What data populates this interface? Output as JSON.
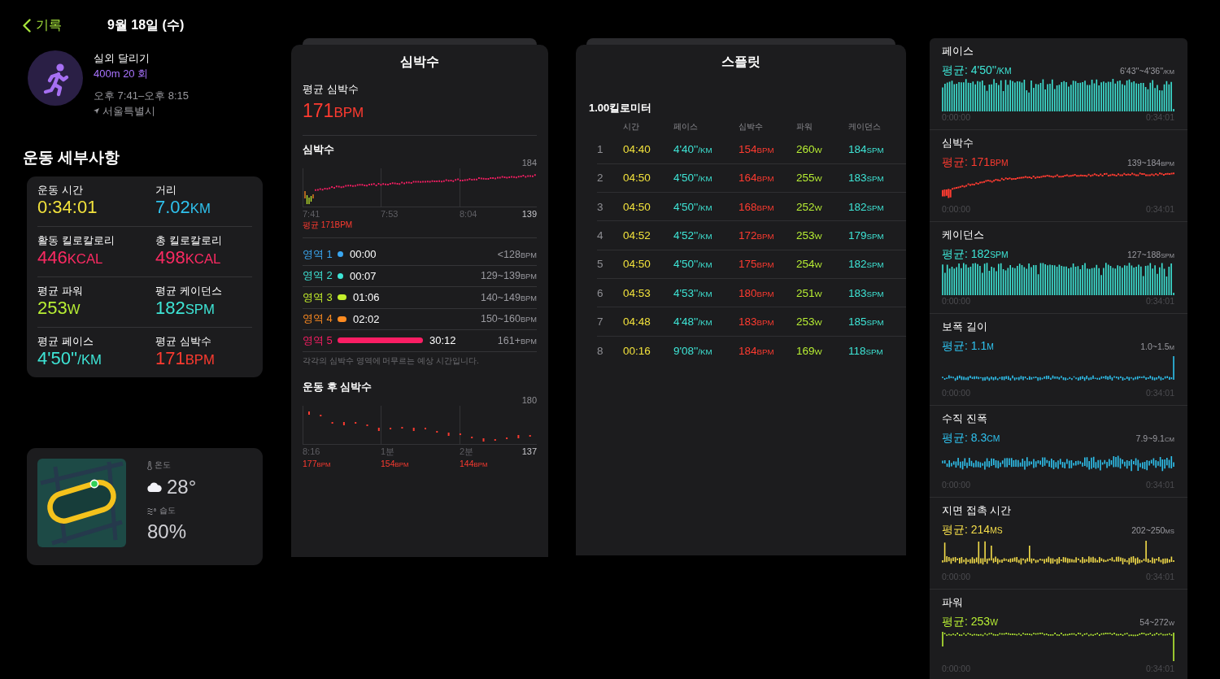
{
  "header": {
    "back_label": "기록",
    "date": "9월 18일 (수)"
  },
  "workout": {
    "type": "실외 달리기",
    "detail": "400m 20 회",
    "time_range": "오후 7:41–오후 8:15",
    "location": "서울특별시"
  },
  "details": {
    "title": "운동 세부사항",
    "metrics": [
      {
        "label": "운동 시간",
        "value": "0:34:01",
        "color": "#f2e23c"
      },
      {
        "label": "거리",
        "value": "7.02",
        "unit": "KM",
        "color": "#2fc2ee"
      },
      {
        "label": "활동 킬로칼로리",
        "value": "446",
        "unit": "KCAL",
        "color": "#fb2a62"
      },
      {
        "label": "총 킬로칼로리",
        "value": "498",
        "unit": "KCAL",
        "color": "#fb2a62"
      },
      {
        "label": "평균 파워",
        "value": "253",
        "unit": "W",
        "color": "#b8ef34"
      },
      {
        "label": "평균 케이던스",
        "value": "182",
        "unit": "SPM",
        "color": "#3ee5d6"
      },
      {
        "label": "평균 페이스",
        "value": "4'50''",
        "unit": "/KM",
        "color": "#3ee5d6"
      },
      {
        "label": "평균 심박수",
        "value": "171",
        "unit": "BPM",
        "color": "#ff3b30"
      }
    ]
  },
  "weather": {
    "temperature_label": "온도",
    "temperature": "28°",
    "humidity_label": "습도",
    "humidity": "80%"
  },
  "heart_rate": {
    "title": "심박수",
    "average_label": "평균 심박수",
    "average": {
      "value": "171",
      "unit": "BPM"
    },
    "chart": {
      "title": "심박수",
      "y_max": "184",
      "y_min": "139",
      "x_labels": [
        "7:41",
        "7:53",
        "8:04"
      ],
      "caption": "평균 171BPM"
    },
    "zones": [
      {
        "label": "영역 1",
        "color": "#3aa7f2",
        "kind": "dot",
        "time": "00:00",
        "range": "<128",
        "unit": "BPM"
      },
      {
        "label": "영역 2",
        "color": "#3ee5d6",
        "kind": "dot",
        "time": "00:07",
        "range": "129~139",
        "unit": "BPM"
      },
      {
        "label": "영역 3",
        "color": "#c4ef2c",
        "kind": "pill",
        "time": "01:06",
        "range": "140~149",
        "unit": "BPM"
      },
      {
        "label": "영역 4",
        "color": "#ff8c21",
        "kind": "pill",
        "time": "02:02",
        "range": "150~160",
        "unit": "BPM"
      },
      {
        "label": "영역 5",
        "color": "#fa1e64",
        "kind": "bar",
        "time": "30:12",
        "range": "161+",
        "unit": "BPM"
      }
    ],
    "note": "각각의 심박수 영역에 머무르는 예상 시간입니다.",
    "recovery": {
      "title": "운동 후 심박수",
      "y_max": "180",
      "y_min": "137",
      "x_labels": [
        "8:16",
        "1분",
        "2분"
      ],
      "readings": [
        {
          "value": "177",
          "unit": "BPM"
        },
        {
          "value": "154",
          "unit": "BPM"
        },
        {
          "value": "144",
          "unit": "BPM"
        }
      ]
    }
  },
  "splits": {
    "title": "스플릿",
    "distance": "1.00킬로미터",
    "columns": [
      {
        "label": "시간",
        "color": "#f2e23c"
      },
      {
        "label": "페이스",
        "color": "#3ee5d6"
      },
      {
        "label": "심박수",
        "color": "#ff3b30"
      },
      {
        "label": "파워",
        "color": "#b8ef34"
      },
      {
        "label": "케이던스",
        "color": "#3ee5d6"
      }
    ],
    "rows": [
      {
        "index": "1",
        "cells": [
          {
            "value": "04:40"
          },
          {
            "value": "4'40''",
            "unit": "/KM"
          },
          {
            "value": "154",
            "unit": "BPM"
          },
          {
            "value": "260",
            "unit": "W"
          },
          {
            "value": "184",
            "unit": "SPM"
          }
        ]
      },
      {
        "index": "2",
        "cells": [
          {
            "value": "04:50"
          },
          {
            "value": "4'50''",
            "unit": "/KM"
          },
          {
            "value": "164",
            "unit": "BPM"
          },
          {
            "value": "255",
            "unit": "W"
          },
          {
            "value": "183",
            "unit": "SPM"
          }
        ]
      },
      {
        "index": "3",
        "cells": [
          {
            "value": "04:50"
          },
          {
            "value": "4'50''",
            "unit": "/KM"
          },
          {
            "value": "168",
            "unit": "BPM"
          },
          {
            "value": "252",
            "unit": "W"
          },
          {
            "value": "182",
            "unit": "SPM"
          }
        ]
      },
      {
        "index": "4",
        "cells": [
          {
            "value": "04:52"
          },
          {
            "value": "4'52''",
            "unit": "/KM"
          },
          {
            "value": "172",
            "unit": "BPM"
          },
          {
            "value": "253",
            "unit": "W"
          },
          {
            "value": "179",
            "unit": "SPM"
          }
        ]
      },
      {
        "index": "5",
        "cells": [
          {
            "value": "04:50"
          },
          {
            "value": "4'50''",
            "unit": "/KM"
          },
          {
            "value": "175",
            "unit": "BPM"
          },
          {
            "value": "254",
            "unit": "W"
          },
          {
            "value": "182",
            "unit": "SPM"
          }
        ]
      },
      {
        "index": "6",
        "cells": [
          {
            "value": "04:53"
          },
          {
            "value": "4'53''",
            "unit": "/KM"
          },
          {
            "value": "180",
            "unit": "BPM"
          },
          {
            "value": "251",
            "unit": "W"
          },
          {
            "value": "183",
            "unit": "SPM"
          }
        ]
      },
      {
        "index": "7",
        "cells": [
          {
            "value": "04:48"
          },
          {
            "value": "4'48''",
            "unit": "/KM"
          },
          {
            "value": "183",
            "unit": "BPM"
          },
          {
            "value": "253",
            "unit": "W"
          },
          {
            "value": "185",
            "unit": "SPM"
          }
        ]
      },
      {
        "index": "8",
        "cells": [
          {
            "value": "00:16"
          },
          {
            "value": "9'08''",
            "unit": "/KM"
          },
          {
            "value": "184",
            "unit": "BPM"
          },
          {
            "value": "169",
            "unit": "W"
          },
          {
            "value": "118",
            "unit": "SPM"
          }
        ]
      }
    ]
  },
  "metric_charts": [
    {
      "title": "페이스",
      "kind": "bars",
      "color": "#3ee5d6",
      "average": "평균: 4'50''",
      "unit": "/KM",
      "range": "6'43''~4'36''",
      "range_unit": "/KM",
      "start": "0:00:00",
      "end": "0:34:01"
    },
    {
      "title": "심박수",
      "kind": "trend",
      "color": "#ff3b30",
      "average": "평균: 171",
      "unit": "BPM",
      "range": "139~184",
      "range_unit": "BPM",
      "start": "0:00:00",
      "end": "0:34:01"
    },
    {
      "title": "케이던스",
      "kind": "bars",
      "color": "#3ee5d6",
      "average": "평균: 182",
      "unit": "SPM",
      "range": "127~188",
      "range_unit": "SPM",
      "start": "0:00:00",
      "end": "0:34:01"
    },
    {
      "title": "보폭 길이",
      "kind": "ticks",
      "color": "#2fc2ee",
      "average": "평균: 1.1",
      "unit": "M",
      "range": "1.0~1.5",
      "range_unit": "M",
      "start": "0:00:00",
      "end": "0:34:01"
    },
    {
      "title": "수직 진폭",
      "kind": "wave",
      "color": "#2fc2ee",
      "average": "평균: 8.3",
      "unit": "CM",
      "range": "7.9~9.1",
      "range_unit": "CM",
      "start": "0:00:00",
      "end": "0:34:01"
    },
    {
      "title": "지면 접촉 시간",
      "kind": "spikes",
      "color": "#f4dd4a",
      "average": "평균: 214",
      "unit": "MS",
      "range": "202~250",
      "range_unit": "MS",
      "start": "0:00:00",
      "end": "0:34:01"
    },
    {
      "title": "파워",
      "kind": "plateau",
      "color": "#b8ef34",
      "average": "평균: 253",
      "unit": "W",
      "range": "54~272",
      "range_unit": "W",
      "start": "0:00:00",
      "end": "0:34:01"
    }
  ]
}
